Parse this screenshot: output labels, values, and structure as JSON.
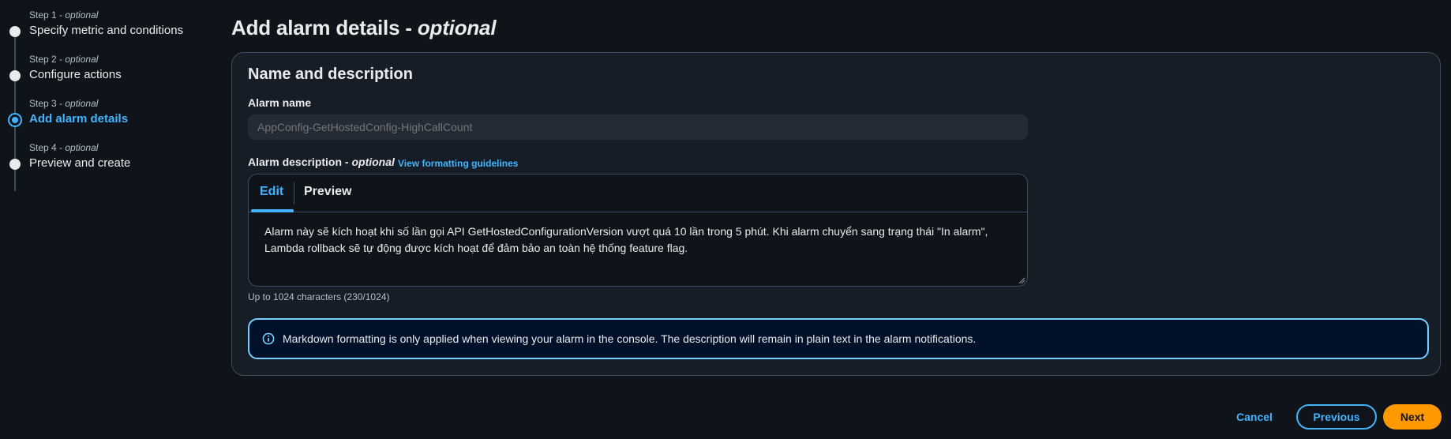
{
  "stepper": {
    "steps": [
      {
        "label": "Step 1",
        "optional": "optional",
        "title": "Specify metric and conditions",
        "state": "done"
      },
      {
        "label": "Step 2",
        "optional": "optional",
        "title": "Configure actions",
        "state": "done"
      },
      {
        "label": "Step 3",
        "optional": "optional",
        "title": "Add alarm details",
        "state": "active"
      },
      {
        "label": "Step 4",
        "optional": "optional",
        "title": "Preview and create",
        "state": "pending"
      }
    ],
    "separator": " - "
  },
  "page": {
    "title": "Add alarm details - ",
    "title_optional": "optional"
  },
  "section": {
    "header": "Name and description",
    "alarm_name": {
      "label": "Alarm name",
      "placeholder": "AppConfig-GetHostedConfig-HighCallCount"
    },
    "alarm_description": {
      "label": "Alarm description - ",
      "label_optional": "optional",
      "link": "View formatting guidelines",
      "tabs": {
        "edit": "Edit",
        "preview": "Preview"
      },
      "value": "Alarm này sẽ kích hoạt khi số lần gọi API GetHostedConfigurationVersion vượt quá 10 lần trong 5 phút. Khi alarm chuyển sang trạng thái \"In alarm\", Lambda rollback sẽ tự động được kích hoạt để đảm bảo an toàn hệ thống feature flag.",
      "char_count": "Up to 1024 characters (230/1024)"
    },
    "info_alert": {
      "icon": "info-icon",
      "text": "Markdown formatting is only applied when viewing your alarm in the console. The description will remain in plain text in the alarm notifications."
    }
  },
  "actions": {
    "cancel": "Cancel",
    "previous": "Previous",
    "next": "Next"
  },
  "colors": {
    "background": "#0f141a",
    "container": "#161d26",
    "accent": "#42b4ff",
    "primary_button": "#ff9900",
    "info_border": "#75cfff"
  }
}
